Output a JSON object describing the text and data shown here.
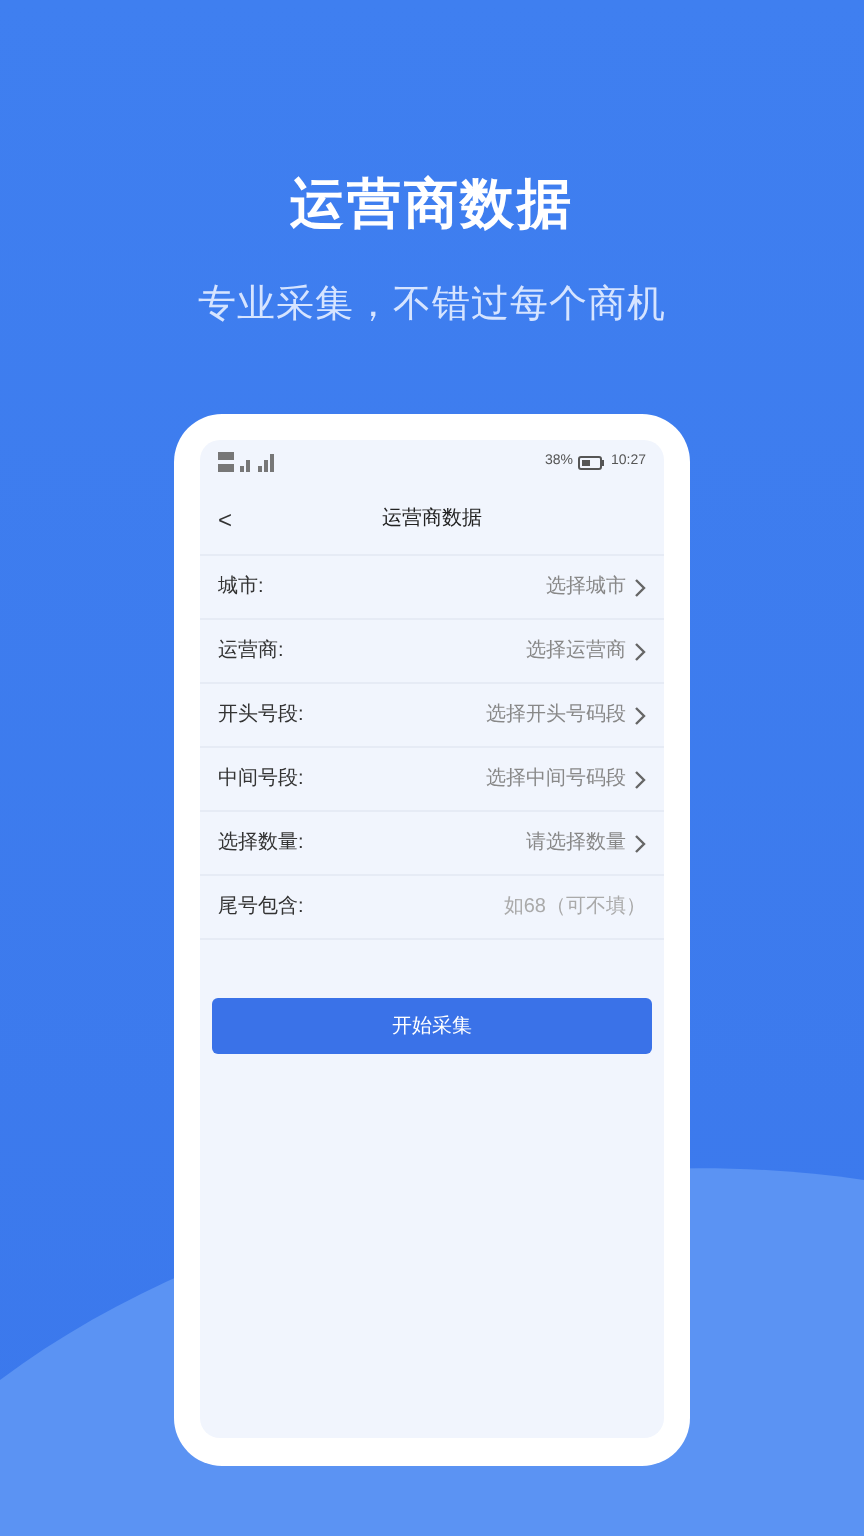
{
  "headline": "运营商数据",
  "tagline": "专业采集，不错过每个商机",
  "status_bar": {
    "battery": "38%",
    "time": "10:27"
  },
  "nav": {
    "back": "<",
    "title": "运营商数据"
  },
  "rows": [
    {
      "kind": "select",
      "label": "城市:",
      "value": "选择城市"
    },
    {
      "kind": "select",
      "label": "运营商:",
      "value": "选择运营商"
    },
    {
      "kind": "select",
      "label": "开头号段:",
      "value": "选择开头号码段"
    },
    {
      "kind": "select",
      "label": "中间号段:",
      "value": "选择中间号码段"
    },
    {
      "kind": "select",
      "label": "选择数量:",
      "value": "请选择数量"
    },
    {
      "kind": "input",
      "label": "尾号包含:",
      "placeholder": "如68（可不填）"
    }
  ],
  "button": "开始采集"
}
